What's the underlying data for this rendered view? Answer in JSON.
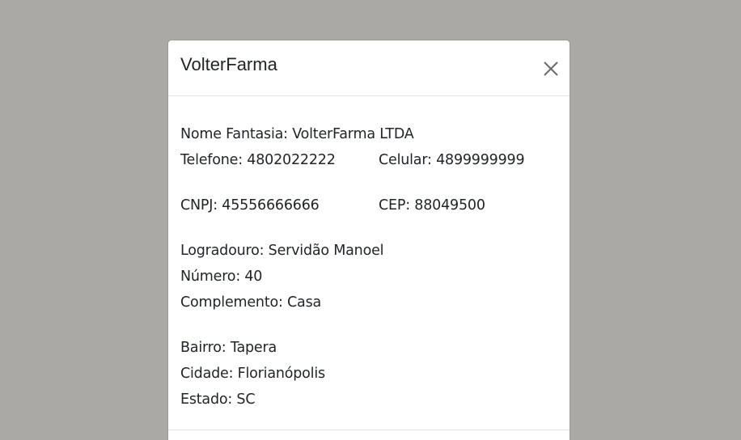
{
  "modal": {
    "title": "VolterFarma",
    "close_icon": "close-icon"
  },
  "details": {
    "nome_fantasia": "Nome Fantasia: VolterFarma LTDA",
    "telefone": "Telefone: 4802022222",
    "celular": "Celular: 4899999999",
    "cnpj": "CNPJ: 45556666666",
    "cep": "CEP: 88049500",
    "logradouro": "Logradouro: Servidão Manoel",
    "numero": "Número: 40",
    "complemento": "Complemento: Casa",
    "bairro": "Bairro: Tapera",
    "cidade": "Cidade: Florianópolis",
    "estado": "Estado: SC"
  },
  "colors": {
    "backdrop": "#aaa9a5",
    "modal_bg": "#ffffff",
    "text": "#212529",
    "close_icon": "#6c6c6c"
  }
}
